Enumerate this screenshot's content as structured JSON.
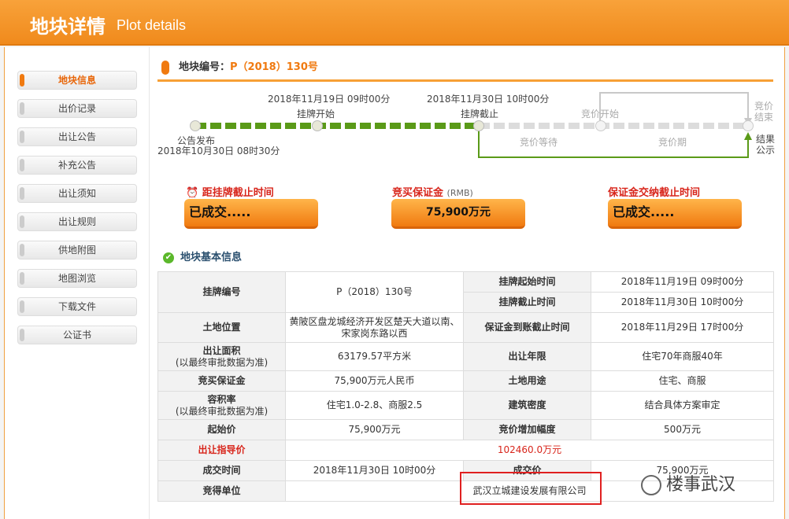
{
  "header": {
    "title_cn": "地块详情",
    "title_en": "Plot details"
  },
  "sidebar": {
    "items": [
      {
        "label": "地块信息"
      },
      {
        "label": "出价记录"
      },
      {
        "label": "出让公告"
      },
      {
        "label": "补充公告"
      },
      {
        "label": "出让须知"
      },
      {
        "label": "出让规则"
      },
      {
        "label": "供地附图"
      },
      {
        "label": "地图浏览"
      },
      {
        "label": "下载文件"
      },
      {
        "label": "公证书"
      }
    ]
  },
  "plot": {
    "label": "地块编号：",
    "code": "P（2018）130号"
  },
  "timeline": {
    "date_listing_start": "2018年11月19日 09时00分",
    "date_listing_end": "2018年11月30日 10时00分",
    "date_announce": "2018年10月30日 08时30分",
    "announce": "公告发布",
    "listing_start": "挂牌开始",
    "listing_end": "挂牌截止",
    "bid_start": "竞价开始",
    "bid_wait": "竞价等待",
    "bid_period": "竞价期",
    "bid_end_1": "竞价",
    "bid_end_2": "结束",
    "result_1": "结果",
    "result_2": "公示"
  },
  "countdown": {
    "deadline_label": "距挂牌截止时间",
    "deadline_value": "已成交.....",
    "deposit_label": "竞买保证金",
    "deposit_unit": "(RMB)",
    "deposit_value": "75,900万元",
    "deposit_deadline_label": "保证金交纳截止时间",
    "deposit_deadline_value": "已成交....."
  },
  "info": {
    "title": "地块基本信息",
    "r1_l1": "挂牌编号",
    "r1_v1": "P（2018）130号",
    "r1_l2": "挂牌起始时间",
    "r1_v2": "2018年11月19日 09时00分",
    "r2_l2": "挂牌截止时间",
    "r2_v2": "2018年11月30日 10时00分",
    "r3_l1": "土地位置",
    "r3_v1": "黄陂区盘龙城经济开发区楚天大道以南、宋家岗东路以西",
    "r3_l2": "保证金到账截止时间",
    "r3_v2": "2018年11月29日 17时00分",
    "r4_l1a": "出让面积",
    "r4_l1b": "(以最终审批数据为准)",
    "r4_v1": "63179.57平方米",
    "r4_l2": "出让年限",
    "r4_v2": "住宅70年商服40年",
    "r5_l1": "竞买保证金",
    "r5_v1": "75,900万元人民币",
    "r5_l2": "土地用途",
    "r5_v2": "住宅、商服",
    "r6_l1a": "容积率",
    "r6_l1b": "(以最终审批数据为准)",
    "r6_v1": "住宅1.0-2.8、商服2.5",
    "r6_l2": "建筑密度",
    "r6_v2": "结合具体方案审定",
    "r7_l1": "起始价",
    "r7_v1": "75,900万元",
    "r7_l2": "竞价增加幅度",
    "r7_v2": "500万元",
    "r8_l1": "出让指导价",
    "r8_v1": "102460.0万元",
    "r9_l1": "成交时间",
    "r9_v1": "2018年11月30日 10时00分",
    "r9_l2": "成交价",
    "r9_v2": "75,900万元",
    "r10_l1": "竞得单位",
    "r10_v1": "武汉立城建设发展有限公司"
  },
  "watermark": "楼事武汉"
}
